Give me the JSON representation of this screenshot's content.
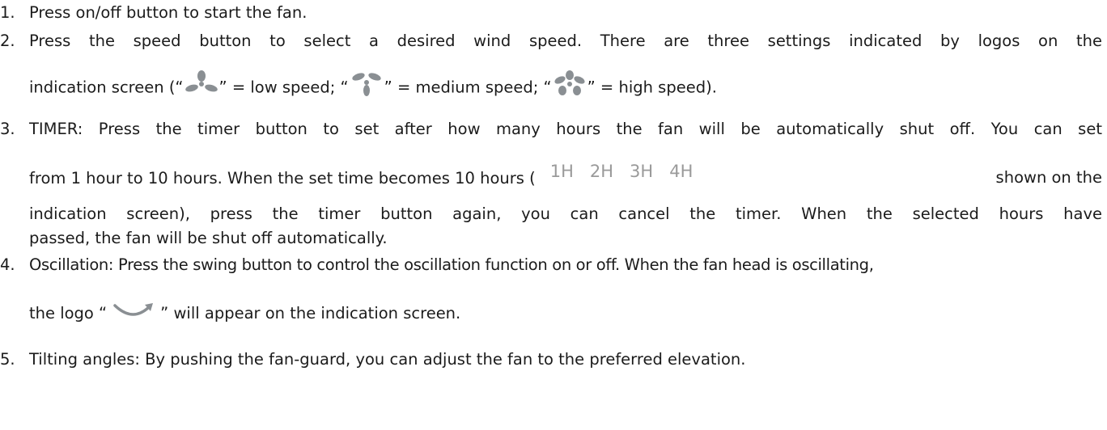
{
  "items": [
    {
      "num": "1.",
      "text": "Press on/off button to start the fan."
    },
    {
      "num": "2.",
      "line1": "Press the speed button to select a desired wind speed. There are three settings indicated by logos on the",
      "line2a": "indication screen (“",
      "line2b": "” = low speed; “",
      "line2c": "” = medium speed; “",
      "line2d": "” = high speed).",
      "icons": [
        "fan-low-icon",
        "fan-medium-icon",
        "fan-high-icon"
      ]
    },
    {
      "num": "3.",
      "line1": "TIMER: Press the timer button to set after how many hours the fan will be automatically shut off. You can set",
      "line2a": "from 1 hour to 10 hours. When the set time becomes 10 hours (",
      "line2b": "shown on the",
      "hours": [
        "1H",
        "2H",
        "3H",
        "4H"
      ],
      "line3": "indication screen), press the timer button again, you can cancel the timer. When the selected hours have",
      "line4": "passed, the fan will be shut off automatically."
    },
    {
      "num": "4.",
      "line1": "Oscillation: Press the swing button to control the oscillation function on or off. When the fan head is oscillating,",
      "line2a": "the logo “",
      "line2b": "” will appear on the indication screen.",
      "icon": "swing-arrow-icon"
    },
    {
      "num": "5.",
      "text": "Tilting angles: By pushing the fan-guard, you can adjust the fan to the preferred elevation."
    }
  ],
  "colors": {
    "text": "#1b1b1b",
    "icon": "#8a8f93",
    "hours": "#9a9a9a"
  }
}
